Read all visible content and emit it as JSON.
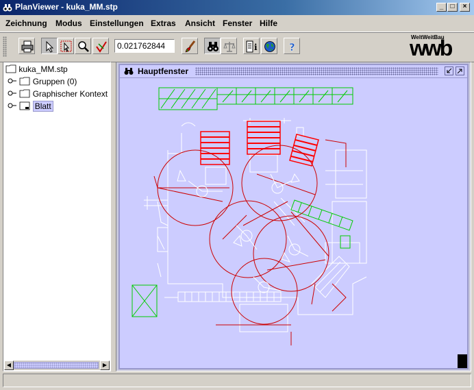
{
  "window": {
    "title": "PlanViewer - kuka_MM.stp"
  },
  "menu": {
    "items": [
      {
        "label": "Zeichnung"
      },
      {
        "label": "Modus"
      },
      {
        "label": "Einstellungen"
      },
      {
        "label": "Extras"
      },
      {
        "label": "Ansicht"
      },
      {
        "label": "Fenster"
      },
      {
        "label": "Hilfe"
      }
    ]
  },
  "toolbar": {
    "zoom_value": "0.021762844",
    "logo_caption": "WeltWeitBau",
    "logo_text": "wwb",
    "icons": [
      "print-icon",
      "select-arrow-icon",
      "select-zoom-icon",
      "magnifier-icon",
      "measure-check-icon",
      "brush-icon",
      "binoculars-icon",
      "scale-icon",
      "info-icon",
      "globe-icon",
      "help-icon"
    ]
  },
  "tree": {
    "root": "kuka_MM.stp",
    "children": [
      {
        "label": "Gruppen (0)"
      },
      {
        "label": "Graphischer Kontext"
      },
      {
        "label": "Blatt",
        "selected": true
      }
    ]
  },
  "internal_frame": {
    "title": "Hauptfenster"
  },
  "colors": {
    "titlebar": "#0a246a",
    "canvas_bg": "#ccccff",
    "drawing_white": "#ffffff",
    "drawing_red": "#ff0000",
    "drawing_circle": "#cc0000",
    "drawing_green": "#00cc00"
  }
}
